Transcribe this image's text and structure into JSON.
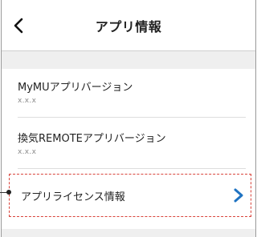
{
  "header": {
    "title": "アプリ情報",
    "back_icon": "chevron-left-icon"
  },
  "items": [
    {
      "label": "MyMUアプリバージョン",
      "value": "x.x.x"
    },
    {
      "label": "換気REMOTEアプリバージョン",
      "value": "x.x.x"
    }
  ],
  "license": {
    "label": "アプリライセンス情報",
    "icon": "chevron-right-icon"
  },
  "colors": {
    "accent_blue": "#1f73c2",
    "highlight_red": "#d9433b",
    "background_gray": "#efefef"
  }
}
